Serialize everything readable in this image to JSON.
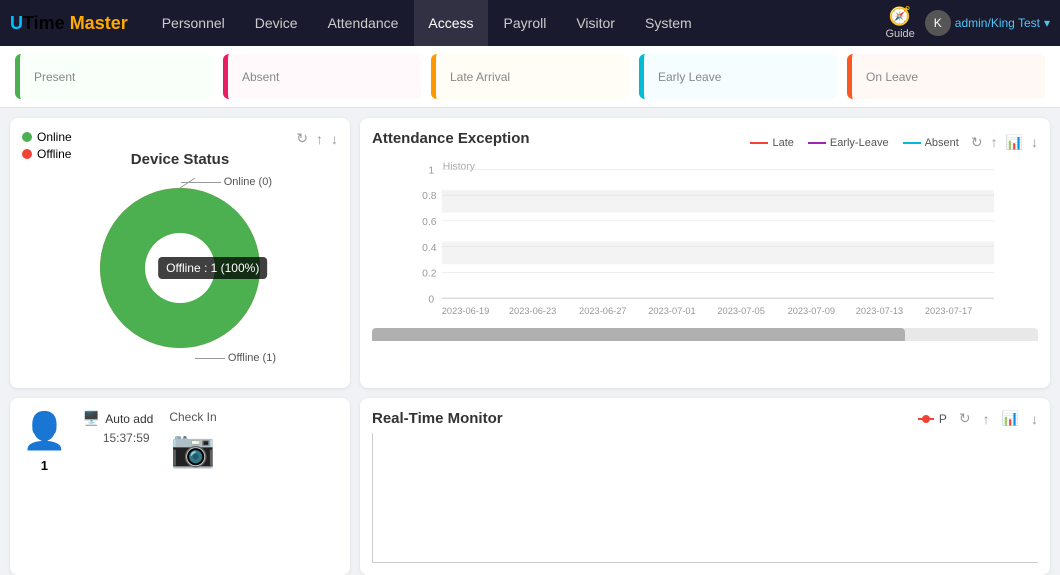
{
  "nav": {
    "logo_u": "U",
    "logo_time": "Time ",
    "logo_master": "Master",
    "items": [
      {
        "label": "Personnel",
        "active": false
      },
      {
        "label": "Device",
        "active": false
      },
      {
        "label": "Attendance",
        "active": false
      },
      {
        "label": "Access",
        "active": true
      },
      {
        "label": "Payroll",
        "active": false
      },
      {
        "label": "Visitor",
        "active": false
      },
      {
        "label": "System",
        "active": false
      }
    ],
    "guide_label": "Guide",
    "user": "admin/King Test"
  },
  "stats": [
    {
      "label": "Present",
      "type": "present"
    },
    {
      "label": "Absent",
      "type": "absent"
    },
    {
      "label": "Late Arrival",
      "type": "late"
    },
    {
      "label": "Early Leave",
      "type": "early"
    },
    {
      "label": "On Leave",
      "type": "onleave"
    }
  ],
  "device_status": {
    "title": "Device Status",
    "legend_online": "Online",
    "legend_offline": "Offline",
    "tooltip": "Offline : 1 (100%)",
    "label_online": "Online (0)",
    "label_offline": "Offline (1)",
    "online_count": 0,
    "offline_count": 1,
    "total": 1
  },
  "attendance": {
    "title": "Attendance Exception",
    "history_label": "History",
    "legend": [
      {
        "label": "Late",
        "color": "#f44336"
      },
      {
        "label": "Early-Leave",
        "color": "#9c27b0"
      },
      {
        "label": "Absent",
        "color": "#00bcd4"
      }
    ],
    "y_labels": [
      "1",
      "0.8",
      "0.6",
      "0.4",
      "0.2",
      "0"
    ],
    "x_labels": [
      "2023-06-19",
      "2023-06-23",
      "2023-06-27",
      "2023-07-01",
      "2023-07-05",
      "2023-07-09",
      "2023-07-13",
      "2023-07-17"
    ]
  },
  "bottom_left": {
    "user_count": "1",
    "auto_add_label": "Auto add",
    "time": "15:37:59",
    "checkin_label": "Check In"
  },
  "realtime": {
    "title": "Real-Time Monitor",
    "legend_label": "P"
  }
}
